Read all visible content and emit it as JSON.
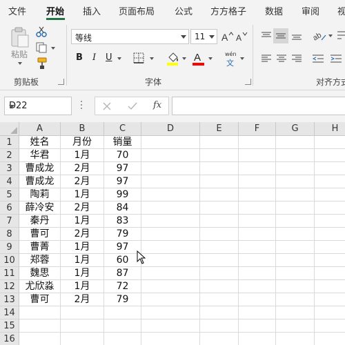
{
  "ribbon_tabs": [
    "文件",
    "开始",
    "插入",
    "页面布局",
    "公式",
    "方方格子",
    "数据",
    "审阅",
    "视"
  ],
  "active_tab": "开始",
  "clipboard": {
    "paste_label": "粘贴",
    "group_label": "剪贴板",
    "icons": [
      "paste-icon",
      "cut-icon",
      "copy-icon",
      "format-painter-icon"
    ]
  },
  "font": {
    "font_name": "等线",
    "font_size": "11",
    "group_label": "字体",
    "bold": "B",
    "italic": "I",
    "underline": "U",
    "font_color": "#ff0000",
    "fill_color": "#ffff00",
    "phonetic_top": "wén",
    "phonetic_bottom": "文"
  },
  "alignment": {
    "group_label": "对齐方式"
  },
  "formula_bar": {
    "name_box": "D22",
    "fx_label": "fx",
    "formula_value": ""
  },
  "grid": {
    "columns": [
      "A",
      "B",
      "C",
      "D",
      "E",
      "F",
      "G",
      "H"
    ],
    "rows": [
      [
        "姓名",
        "月份",
        "销量"
      ],
      [
        "华君",
        "1月",
        "70"
      ],
      [
        "曹成龙",
        "2月",
        "97"
      ],
      [
        "曹成龙",
        "2月",
        "97"
      ],
      [
        "陶莉",
        "1月",
        "99"
      ],
      [
        "薛冷安",
        "2月",
        "84"
      ],
      [
        "秦丹",
        "1月",
        "83"
      ],
      [
        "曹可",
        "2月",
        "79"
      ],
      [
        "曹菁",
        "1月",
        "97"
      ],
      [
        "郑蓉",
        "1月",
        "60"
      ],
      [
        "魏思",
        "1月",
        "87"
      ],
      [
        "尤欣淼",
        "1月",
        "72"
      ],
      [
        "曹可",
        "2月",
        "79"
      ],
      [
        "",
        "",
        ""
      ],
      [
        "",
        "",
        ""
      ],
      [
        "",
        "",
        ""
      ]
    ]
  },
  "colors": {
    "accent": "#217346",
    "ribbon_bg": "#f3f3f3",
    "header_bg": "#e6e6e6"
  }
}
